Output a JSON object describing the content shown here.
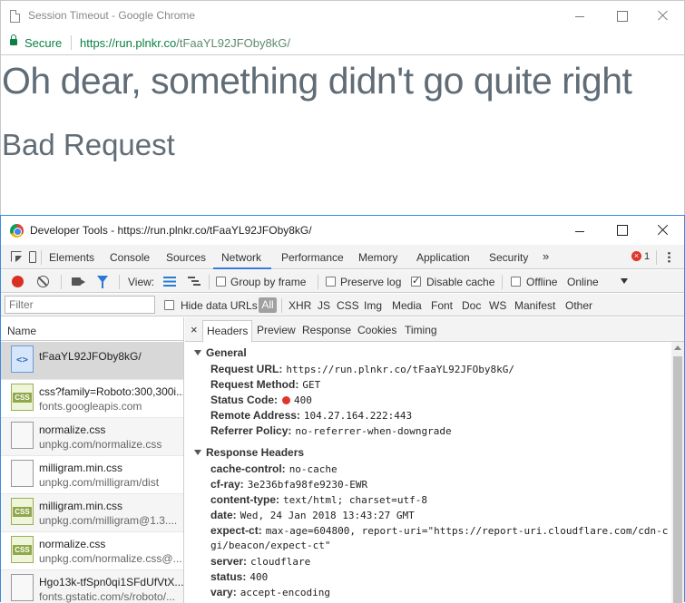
{
  "browser": {
    "title": "Session Timeout - Google Chrome",
    "secure_label": "Secure",
    "url_scheme": "https://",
    "url_host": "run.plnkr.co",
    "url_path": "/tFaaYL92JFOby8kG/"
  },
  "page": {
    "heading": "Oh dear, something didn't go quite right",
    "subheading": "Bad Request"
  },
  "devtools": {
    "title": "Developer Tools - https://run.plnkr.co/tFaaYL92JFOby8kG/",
    "tabs": [
      "Elements",
      "Console",
      "Sources",
      "Network",
      "Performance",
      "Memory",
      "Application",
      "Security"
    ],
    "active_tab": "Network",
    "overflow": "»",
    "error_count": "1",
    "toolbar": {
      "view_label": "View:",
      "group_by_frame": "Group by frame",
      "preserve_log": "Preserve log",
      "disable_cache": "Disable cache",
      "offline": "Offline",
      "throttle": "Online"
    },
    "filter": {
      "placeholder": "Filter",
      "hide_data_urls": "Hide data URLs",
      "all": "All",
      "types": [
        "XHR",
        "JS",
        "CSS",
        "Img",
        "Media",
        "Font",
        "Doc",
        "WS",
        "Manifest",
        "Other"
      ]
    },
    "list": {
      "header": "Name",
      "items": [
        {
          "name": "tFaaYL92JFOby8kG/",
          "sub": "",
          "icon": "html-file-icon"
        },
        {
          "name": "css?family=Roboto:300,300i...",
          "sub": "fonts.googleapis.com",
          "icon": "css-file-icon"
        },
        {
          "name": "normalize.css",
          "sub": "unpkg.com/normalize.css",
          "icon": "blank-file-icon"
        },
        {
          "name": "milligram.min.css",
          "sub": "unpkg.com/milligram/dist",
          "icon": "blank-file-icon"
        },
        {
          "name": "milligram.min.css",
          "sub": "unpkg.com/milligram@1.3....",
          "icon": "css-file-icon"
        },
        {
          "name": "normalize.css",
          "sub": "unpkg.com/normalize.css@...",
          "icon": "css-file-icon"
        },
        {
          "name": "Hgo13k-tfSpn0qi1SFdUfVtX...",
          "sub": "fonts.gstatic.com/s/roboto/...",
          "icon": "blank-file-icon"
        }
      ]
    },
    "detail": {
      "close": "×",
      "tabs": [
        "Headers",
        "Preview",
        "Response",
        "Cookies",
        "Timing"
      ],
      "active_tab": "Headers",
      "general_title": "General",
      "general": [
        {
          "k": "Request URL:",
          "v": "https://run.plnkr.co/tFaaYL92JFOby8kG/"
        },
        {
          "k": "Request Method:",
          "v": "GET"
        },
        {
          "k": "Status Code:",
          "v": "400"
        },
        {
          "k": "Remote Address:",
          "v": "104.27.164.222:443"
        },
        {
          "k": "Referrer Policy:",
          "v": "no-referrer-when-downgrade"
        }
      ],
      "response_title": "Response Headers",
      "response": [
        {
          "k": "cache-control:",
          "v": "no-cache"
        },
        {
          "k": "cf-ray:",
          "v": "3e236bfa98fe9230-EWR"
        },
        {
          "k": "content-type:",
          "v": "text/html; charset=utf-8"
        },
        {
          "k": "date:",
          "v": "Wed, 24 Jan 2018 13:43:27 GMT"
        },
        {
          "k": "expect-ct:",
          "v": "max-age=604800, report-uri=\"https://report-uri.cloudflare.com/cdn-c"
        },
        {
          "k": "",
          "v": "gi/beacon/expect-ct\""
        },
        {
          "k": "server:",
          "v": "cloudflare"
        },
        {
          "k": "status:",
          "v": "400"
        },
        {
          "k": "vary:",
          "v": "accept-encoding"
        }
      ]
    }
  },
  "colors": {
    "secure_green": "#0b8043",
    "accent_blue": "#3879d9",
    "error_red": "#e0352b",
    "heading_gray": "#606c76"
  }
}
